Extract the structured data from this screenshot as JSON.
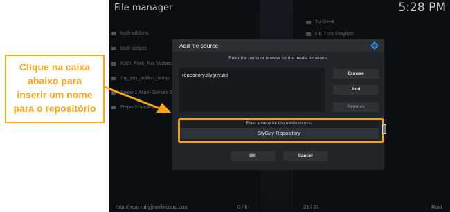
{
  "window": {
    "title": "File manager",
    "clock": "5:28 PM"
  },
  "left_sources": [
    "kodi-addons",
    "kodi-scripts",
    "Kodi_Fork_No_Wizard",
    "my_jen_addon_temp",
    "Repo-1-Main-Server-2",
    "Repo-2-backup"
  ],
  "right_sources": [
    "Tv Geek",
    "UK Turk Playlists"
  ],
  "footer": {
    "path": "http://repo.rubyjewelwizard.com",
    "left_count": "0 / 6",
    "right_count": "21 / 21",
    "right_label": "Root"
  },
  "dialog": {
    "title": "Add file source",
    "subtitle": "Enter the paths or browse for the media locations.",
    "path_value": "repository.slyguy.zip",
    "browse_label": "Browse",
    "add_label": "Add",
    "remove_label": "Remove",
    "name_prompt": "Enter a name for this media source.",
    "name_value": "SlyGuy Repository",
    "ok_label": "OK",
    "cancel_label": "Cancel"
  },
  "callout": {
    "text": "Clique na caixa\nabaixo para\ninserir um nome\npara o repositório"
  },
  "colors": {
    "accent": "#f7a51c",
    "dialog_bg": "#21252a",
    "app_bg": "#0c0f12"
  }
}
